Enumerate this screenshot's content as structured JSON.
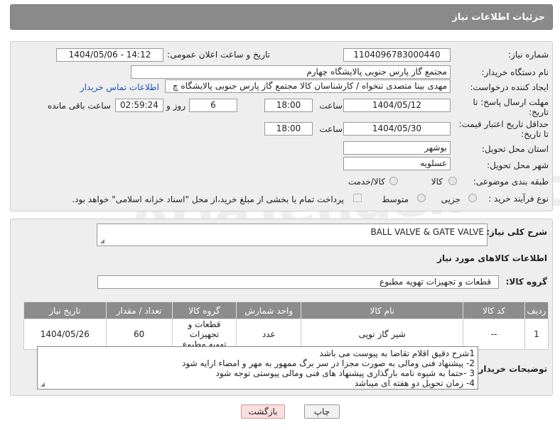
{
  "header": {
    "title": "جزئیات اطلاعات نیاز"
  },
  "form": {
    "need_number": {
      "label": "شماره نیاز:",
      "value": "1104096783000440"
    },
    "announce_datetime": {
      "label": "تاریخ و ساعت اعلان عمومی:",
      "value": "1404/05/06 - 14:12"
    },
    "buyer_org": {
      "label": "نام دستگاه خریدار:",
      "value": "مجتمع گاز پارس جنوبی  پالایشگاه چهارم"
    },
    "creator": {
      "label": "ایجاد کننده درخواست:",
      "value": "مهدی بینا متصدی تنخواه / کارشناسان کالا مجتمع گاز پارس جنوبی  پالایشگاه چ",
      "contact_link": "اطلاعات تماس خریدار"
    },
    "reply_deadline": {
      "label_line1": "مهلت ارسال پاسخ: تا",
      "label_line2": "تاریخ:",
      "date": "1404/05/12",
      "time_label": "ساعت",
      "time": "18:00",
      "days": "6",
      "days_label": "روز و",
      "remaining": "02:59:24",
      "remaining_label": "ساعت باقی مانده"
    },
    "price_validity": {
      "label_line1": "حداقل تاریخ اعتبار قیمت:",
      "label_line2": "تا تاریخ:",
      "date": "1404/05/30",
      "time_label": "ساعت",
      "time": "18:00"
    },
    "delivery_province": {
      "label": "استان محل تحویل:",
      "value": "بوشهر"
    },
    "delivery_city": {
      "label": "شهر محل تحویل:",
      "value": "عسلویه"
    },
    "category": {
      "label": "طبقه بندی موضوعی:",
      "options": [
        "کالا",
        "کالا/خدمت"
      ]
    },
    "purchase_type": {
      "label": "نوع فرآیند خرید :",
      "options": [
        "جزیی",
        "متوسط"
      ],
      "payment_note": "پرداخت تمام یا بخشی از مبلغ خرید،از محل \"اسناد خزانه اسلامی\" خواهد بود."
    }
  },
  "summary": {
    "label": "شرح کلی نیاز:",
    "value": "BALL VALVE & GATE VALVE"
  },
  "goods_section": {
    "title": "اطلاعات کالاهای مورد نیاز",
    "group_label": "گروه کالا:",
    "group_value": "قطعات و تجهیزات تهویه مطبوع",
    "columns": [
      "ردیف",
      "کد کالا",
      "نام کالا",
      "واحد شمارش",
      "گروه کالا",
      "تعداد / مقدار",
      "تاریخ نیاز"
    ],
    "rows": [
      {
        "row": "1",
        "code": "--",
        "name": "شیر گاز توپی",
        "unit": "عدد",
        "group_line1": "قطعات و تجهیزات",
        "group_line2": "تهویه مطبوع",
        "qty": "60",
        "date": "1404/05/26"
      }
    ]
  },
  "buyer_notes": {
    "label": "توضیحات خریدار:",
    "lines": [
      "1شرح دقیق اقلام تقاضا به پیوست  می باشد",
      "2- پیشنهاد فنی ومالی به صورت مجزا در سر برگ ممهور به مهر و امضاء ارایه شود",
      "3 -حتما به شیوه نامه بارگذاری پیشنهاد های فنی ومالی پیوستی توجه شود",
      "4- زمان تحویل دو هفته ای میباشد"
    ]
  },
  "buttons": {
    "print": "چاپ",
    "back": "بازگشت"
  },
  "watermark": "AriaTender.net"
}
